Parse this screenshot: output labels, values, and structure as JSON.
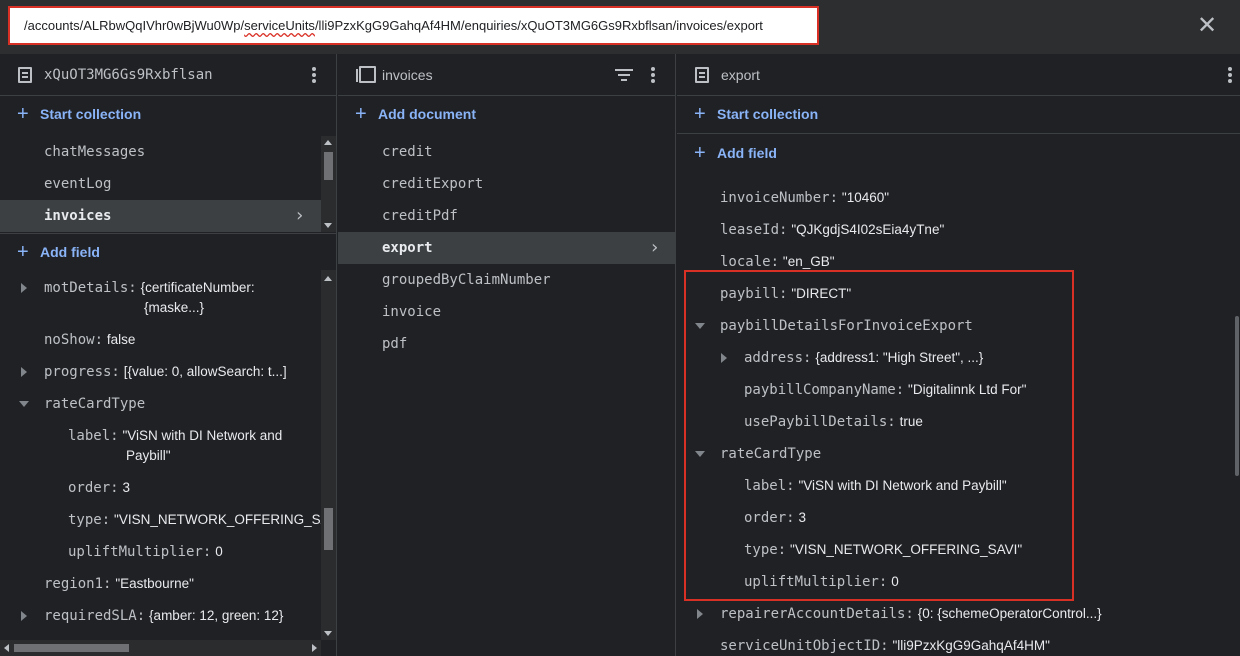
{
  "path": {
    "parts": [
      "/accounts/ALRbwQqIVhr0wBjWu0Wp/",
      "serviceUnits",
      "/lli9PzxKgG9GahqAf4HM/enquiries/xQuOT3MG6Gs9Rxbflsan/invoices/export"
    ]
  },
  "panel1": {
    "title": "xQuOT3MG6Gs9Rxbflsan",
    "start_collection": "Start collection",
    "collections": [
      {
        "label": "chatMessages"
      },
      {
        "label": "eventLog"
      },
      {
        "label": "invoices"
      }
    ],
    "add_field": "Add field",
    "fields": {
      "motDetails_key": "motDetails:",
      "motDetails_val1": "{certificateNumber:",
      "motDetails_val2": "{maske...}",
      "noShow_key": "noShow:",
      "noShow_val": "false",
      "progress_key": "progress:",
      "progress_val": "[{value: 0, allowSearch: t...]",
      "rateCardType_key": "rateCardType",
      "label_key": "label:",
      "label_val1": "\"ViSN with DI Network and",
      "label_val2": "Paybill\"",
      "order_key": "order:",
      "order_val": "3",
      "type_key": "type:",
      "type_val": "\"VISN_NETWORK_OFFERING_SAVI\"",
      "uplift_key": "upliftMultiplier:",
      "uplift_val": "0",
      "region_key": "region1:",
      "region_val": "\"Eastbourne\"",
      "sla_key": "requiredSLA:",
      "sla_val": "{amber: 12, green: 12}"
    }
  },
  "panel2": {
    "title": "invoices",
    "add_document": "Add document",
    "documents": [
      {
        "label": "credit"
      },
      {
        "label": "creditExport"
      },
      {
        "label": "creditPdf"
      },
      {
        "label": "export"
      },
      {
        "label": "groupedByClaimNumber"
      },
      {
        "label": "invoice"
      },
      {
        "label": "pdf"
      }
    ]
  },
  "panel3": {
    "title": "export",
    "start_collection": "Start collection",
    "add_field": "Add field",
    "fields": {
      "invoiceNumber_key": "invoiceNumber:",
      "invoiceNumber_val": "\"10460\"",
      "leaseId_key": "leaseId:",
      "leaseId_val": "\"QJKgdjS4I02sEia4yTne\"",
      "locale_key": "locale:",
      "locale_val": "\"en_GB\"",
      "paybill_key": "paybill:",
      "paybill_val": "\"DIRECT\"",
      "pdfie_key": "paybillDetailsForInvoiceExport",
      "address_key": "address:",
      "address_val": "{address1: \"High Street\", ...}",
      "pcn_key": "paybillCompanyName:",
      "pcn_val": "\"Digitalinnk Ltd For\"",
      "upd_key": "usePaybillDetails:",
      "upd_val": "true",
      "rct_key": "rateCardType",
      "label_key": "label:",
      "label_val": "\"ViSN with DI Network and Paybill\"",
      "order_key": "order:",
      "order_val": "3",
      "type_key": "type:",
      "type_val": "\"VISN_NETWORK_OFFERING_SAVI\"",
      "uplift_key": "upliftMultiplier:",
      "uplift_val": "0",
      "rad_key": "repairerAccountDetails:",
      "rad_val": "{0: {schemeOperatorControl...}",
      "suo_key": "serviceUnitObjectID:",
      "suo_val": "\"lli9PzxKgG9GahqAf4HM\""
    }
  },
  "colors": {
    "background": "#202124",
    "accent": "#8ab4f8",
    "highlight_border": "#d93025"
  },
  "icons": [
    "close-icon",
    "document-icon",
    "collection-icon",
    "kebab-menu-icon",
    "filter-icon",
    "plus-icon",
    "chevron-right-icon",
    "expand-arrow-icon",
    "collapse-arrow-icon"
  ]
}
